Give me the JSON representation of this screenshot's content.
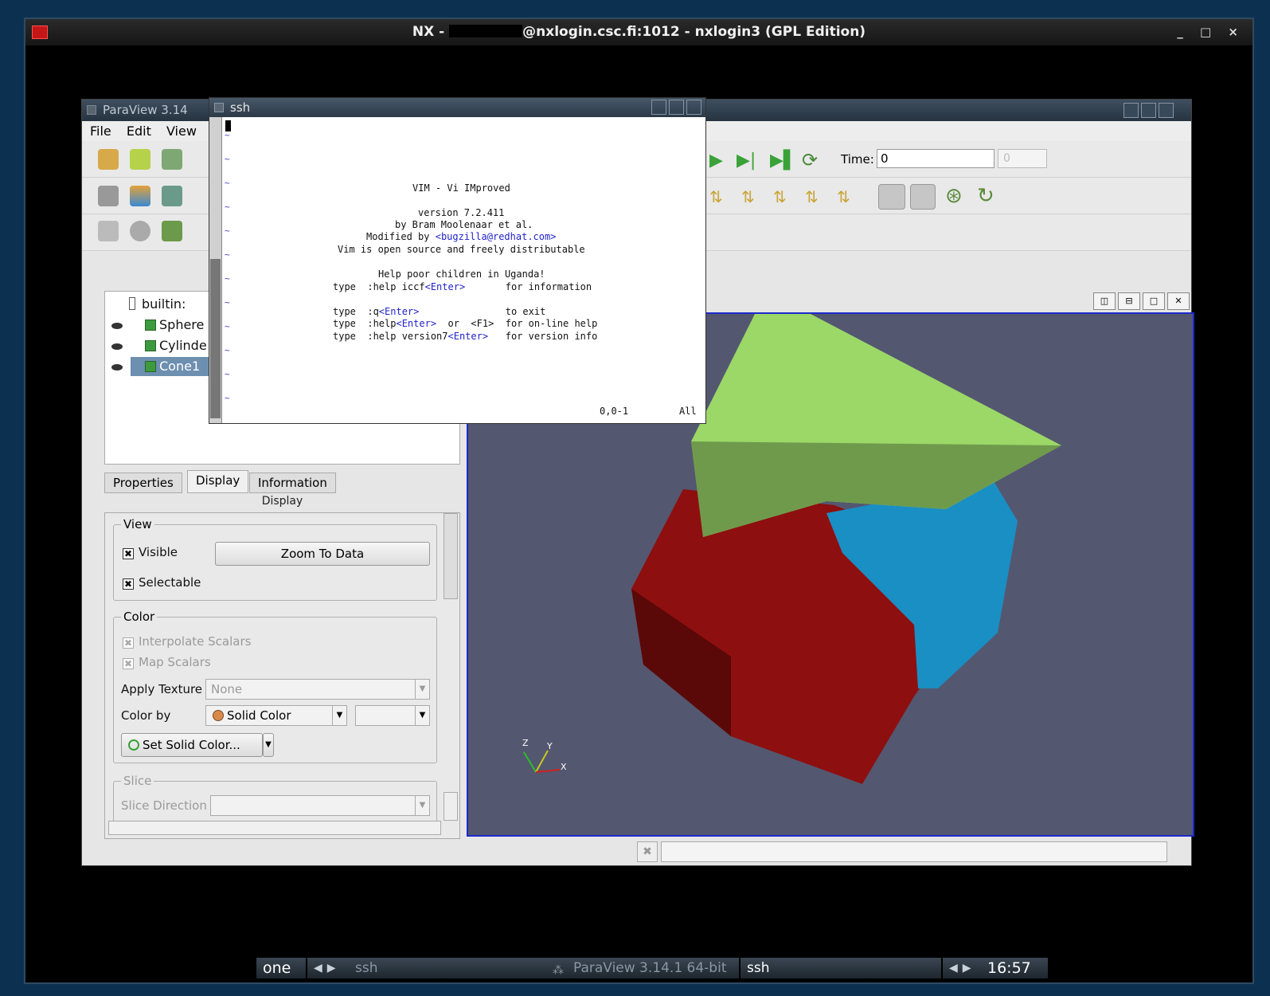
{
  "nx": {
    "title_prefix": "NX -",
    "title_rest": "@nxlogin.csc.fi:1012 - nxlogin3 (GPL Edition)",
    "controls": "_ □ ×"
  },
  "paraview": {
    "title": "ParaView 3.14",
    "menu": [
      "File",
      "Edit",
      "View"
    ],
    "time_label": "Time:",
    "time_value": "0",
    "time_spin": "0",
    "pipeline": {
      "root": "builtin:",
      "items": [
        "Sphere",
        "Cylinde",
        "Cone1"
      ]
    },
    "tabs": [
      "Properties",
      "Display",
      "Information"
    ],
    "display_header": "Display",
    "view_group": "View",
    "visible": "Visible",
    "selectable": "Selectable",
    "zoom_button": "Zoom To Data",
    "color_group": "Color",
    "interpolate": "Interpolate Scalars",
    "map_scalars": "Map Scalars",
    "apply_texture_label": "Apply Texture",
    "apply_texture_value": "None",
    "color_by_label": "Color by",
    "color_by_value": "Solid Color",
    "set_solid_color": "Set Solid Color...",
    "slice_group": "Slice",
    "slice_direction": "Slice Direction",
    "axes": {
      "z": "Z",
      "y": "Y",
      "x": "X"
    }
  },
  "ssh": {
    "title": "ssh",
    "vim": [
      "VIM - Vi IMproved",
      "version 7.2.411",
      "by Bram Moolenaar et al.",
      "Modified by",
      "<bugzilla@redhat.com>",
      "Vim is open source and freely distributable",
      "Help poor children in Uganda!"
    ],
    "help_lines": [
      {
        "a": "type  :help iccf",
        "b": "<Enter>",
        "c": "       for information"
      },
      {
        "a": "type  :q",
        "b": "<Enter>",
        "c": "               to exit"
      },
      {
        "a": "type  :help",
        "b": "<Enter>",
        "c": "  or  <F1>  for on-line help"
      },
      {
        "a": "type  :help version7",
        "b": "<Enter>",
        "c": "   for version info"
      }
    ],
    "pos": "0,0-1",
    "all": "All"
  },
  "taskbar": {
    "desk": "one",
    "ssh1": "ssh",
    "paraview": "ParaView 3.14.1 64-bit",
    "ssh2": "ssh",
    "clock": "16:57"
  }
}
